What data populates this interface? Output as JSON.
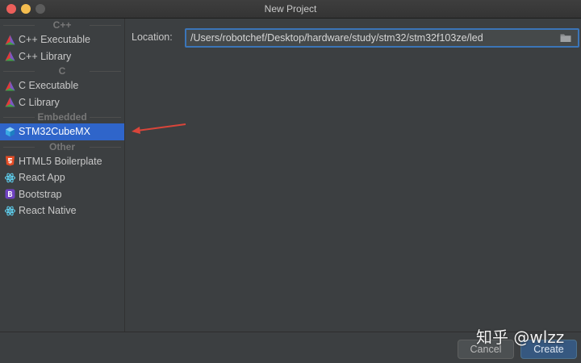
{
  "window": {
    "title": "New Project"
  },
  "sidebar": {
    "groups": [
      {
        "header": "C++",
        "items": [
          {
            "label": "C++ Executable",
            "icon": "cmake-triangle-icon"
          },
          {
            "label": "C++ Library",
            "icon": "cmake-triangle-icon"
          }
        ]
      },
      {
        "header": "C",
        "items": [
          {
            "label": "C Executable",
            "icon": "cmake-triangle-icon"
          },
          {
            "label": "C Library",
            "icon": "cmake-triangle-icon"
          }
        ]
      },
      {
        "header": "Embedded",
        "items": [
          {
            "label": "STM32CubeMX",
            "icon": "cube-icon",
            "selected": true
          }
        ]
      },
      {
        "header": "Other",
        "items": [
          {
            "label": "HTML5 Boilerplate",
            "icon": "html5-icon"
          },
          {
            "label": "React App",
            "icon": "react-icon"
          },
          {
            "label": "Bootstrap",
            "icon": "bootstrap-icon"
          },
          {
            "label": "React Native",
            "icon": "react-icon"
          }
        ]
      }
    ]
  },
  "location": {
    "label": "Location:",
    "value": "/Users/robotchef/Desktop/hardware/study/stm32/stm32f103ze/led"
  },
  "buttons": {
    "cancel": "Cancel",
    "create": "Create"
  },
  "watermark": "知乎 @wlzz",
  "colors": {
    "selection": "#2f65ca",
    "annotation_arrow": "#d9453a",
    "focus_border": "#3b75b8"
  }
}
